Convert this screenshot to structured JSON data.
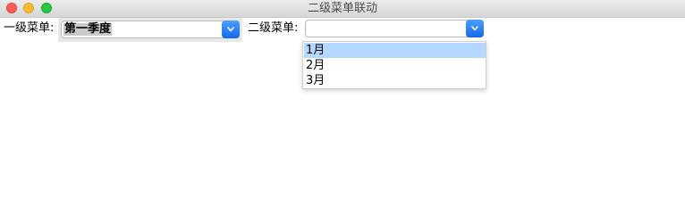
{
  "window": {
    "title": "二级菜单联动"
  },
  "form": {
    "menu1_label": "一级菜单:",
    "menu1_value": "第一季度",
    "menu2_label": "二级菜单:",
    "menu2_value": ""
  },
  "dropdown": {
    "items": [
      "1月",
      "2月",
      "3月"
    ],
    "highlighted_index": 0
  },
  "colors": {
    "accent": "#1a73e8",
    "highlight": "#b4d8fd"
  }
}
